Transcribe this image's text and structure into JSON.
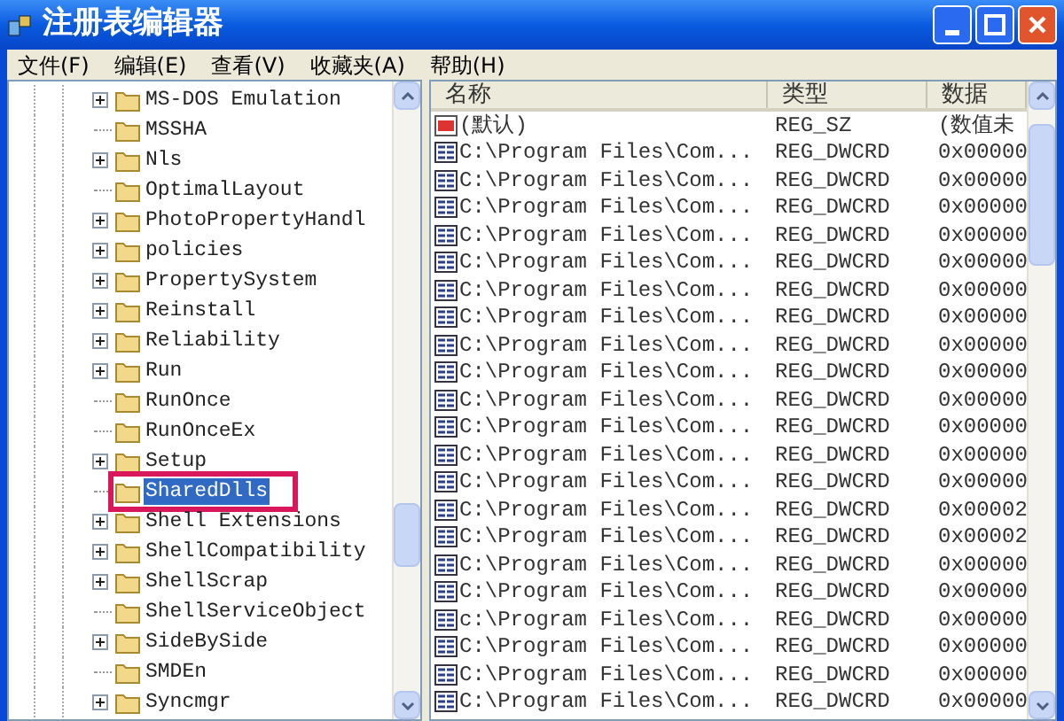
{
  "window": {
    "title": "注册表编辑器"
  },
  "menu": [
    "文件(F)",
    "编辑(E)",
    "查看(V)",
    "收藏夹(A)",
    "帮助(H)"
  ],
  "tree": [
    {
      "label": "MS-DOS Emulation",
      "has_children": true,
      "selected": false,
      "highlighted": false
    },
    {
      "label": "MSSHA",
      "has_children": false,
      "selected": false,
      "highlighted": false
    },
    {
      "label": "Nls",
      "has_children": true,
      "selected": false,
      "highlighted": false
    },
    {
      "label": "OptimalLayout",
      "has_children": false,
      "selected": false,
      "highlighted": false
    },
    {
      "label": "PhotoPropertyHandl",
      "has_children": true,
      "selected": false,
      "highlighted": false
    },
    {
      "label": "policies",
      "has_children": true,
      "selected": false,
      "highlighted": false
    },
    {
      "label": "PropertySystem",
      "has_children": true,
      "selected": false,
      "highlighted": false
    },
    {
      "label": "Reinstall",
      "has_children": true,
      "selected": false,
      "highlighted": false
    },
    {
      "label": "Reliability",
      "has_children": true,
      "selected": false,
      "highlighted": false
    },
    {
      "label": "Run",
      "has_children": true,
      "selected": false,
      "highlighted": false
    },
    {
      "label": "RunOnce",
      "has_children": false,
      "selected": false,
      "highlighted": false
    },
    {
      "label": "RunOnceEx",
      "has_children": false,
      "selected": false,
      "highlighted": false
    },
    {
      "label": "Setup",
      "has_children": true,
      "selected": false,
      "highlighted": false
    },
    {
      "label": "SharedDlls",
      "has_children": false,
      "selected": true,
      "highlighted": true
    },
    {
      "label": "Shell Extensions",
      "has_children": true,
      "selected": false,
      "highlighted": false
    },
    {
      "label": "ShellCompatibility",
      "has_children": true,
      "selected": false,
      "highlighted": false
    },
    {
      "label": "ShellScrap",
      "has_children": true,
      "selected": false,
      "highlighted": false
    },
    {
      "label": "ShellServiceObject",
      "has_children": false,
      "selected": false,
      "highlighted": false
    },
    {
      "label": "SideBySide",
      "has_children": true,
      "selected": false,
      "highlighted": false
    },
    {
      "label": "SMDEn",
      "has_children": false,
      "selected": false,
      "highlighted": false
    },
    {
      "label": "Syncmgr",
      "has_children": true,
      "selected": false,
      "highlighted": false
    }
  ],
  "table": {
    "columns": [
      "名称",
      "类型",
      "数据"
    ],
    "rows": [
      {
        "kind": "string",
        "name": "(默认)",
        "type": "REG_SZ",
        "data": "(数值未"
      },
      {
        "kind": "dword",
        "name": "C:\\Program Files\\Com...",
        "type": "REG_DWCRD",
        "data": "0x00000"
      },
      {
        "kind": "dword",
        "name": "C:\\Program Files\\Com...",
        "type": "REG_DWCRD",
        "data": "0x00000"
      },
      {
        "kind": "dword",
        "name": "C:\\Program Files\\Com...",
        "type": "REG_DWCRD",
        "data": "0x00000"
      },
      {
        "kind": "dword",
        "name": "C:\\Program Files\\Com...",
        "type": "REG_DWCRD",
        "data": "0x00000"
      },
      {
        "kind": "dword",
        "name": "C:\\Program Files\\Com...",
        "type": "REG_DWCRD",
        "data": "0x00000"
      },
      {
        "kind": "dword",
        "name": "C:\\Program Files\\Com...",
        "type": "REG_DWCRD",
        "data": "0x00000"
      },
      {
        "kind": "dword",
        "name": "C:\\Program Files\\Com...",
        "type": "REG_DWCRD",
        "data": "0x00000"
      },
      {
        "kind": "dword",
        "name": "C:\\Program Files\\Com...",
        "type": "REG_DWCRD",
        "data": "0x00000"
      },
      {
        "kind": "dword",
        "name": "C:\\Program Files\\Com...",
        "type": "REG_DWCRD",
        "data": "0x00000"
      },
      {
        "kind": "dword",
        "name": "C:\\Program Files\\Com...",
        "type": "REG_DWCRD",
        "data": "0x00000"
      },
      {
        "kind": "dword",
        "name": "C:\\Program Files\\Com...",
        "type": "REG_DWCRD",
        "data": "0x00000"
      },
      {
        "kind": "dword",
        "name": "C:\\Program Files\\Com...",
        "type": "REG_DWCRD",
        "data": "0x00000"
      },
      {
        "kind": "dword",
        "name": "C:\\Program Files\\Com...",
        "type": "REG_DWCRD",
        "data": "0x00000"
      },
      {
        "kind": "dword",
        "name": "C:\\Program Files\\Com...",
        "type": "REG_DWCRD",
        "data": "0x00002"
      },
      {
        "kind": "dword",
        "name": "C:\\Program Files\\Com...",
        "type": "REG_DWCRD",
        "data": "0x00002"
      },
      {
        "kind": "dword",
        "name": "C:\\Program Files\\Com...",
        "type": "REG_DWCRD",
        "data": "0x00000"
      },
      {
        "kind": "dword",
        "name": "C:\\Program Files\\Com...",
        "type": "REG_DWCRD",
        "data": "0x00000"
      },
      {
        "kind": "dword",
        "name": "c:\\Program Files\\Com...",
        "type": "REG_DWCRD",
        "data": "0x00000"
      },
      {
        "kind": "dword",
        "name": "C:\\Program Files\\Com...",
        "type": "REG_DWCRD",
        "data": "0x00000"
      },
      {
        "kind": "dword",
        "name": "C:\\Program Files\\Com...",
        "type": "REG_DWCRD",
        "data": "0x00000"
      },
      {
        "kind": "dword",
        "name": "C:\\Program Files\\Com...",
        "type": "REG_DWCRD",
        "data": "0x00000"
      }
    ]
  }
}
